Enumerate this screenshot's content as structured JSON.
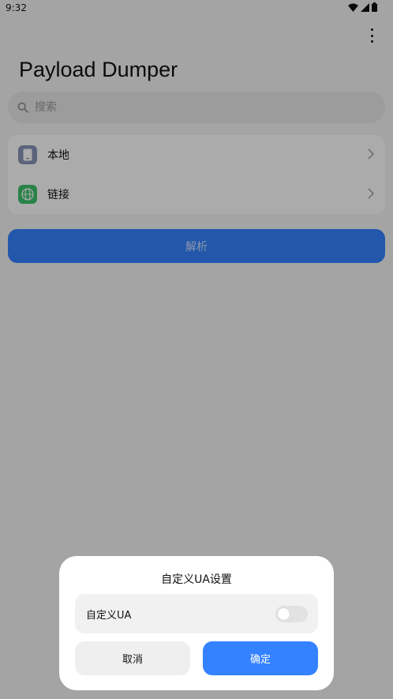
{
  "status_bar": {
    "time": "9:32"
  },
  "app": {
    "title": "Payload Dumper",
    "search": {
      "placeholder": "搜索",
      "value": ""
    },
    "sources": [
      {
        "label": "本地",
        "icon": "phone-icon"
      },
      {
        "label": "链接",
        "icon": "globe-icon"
      }
    ],
    "parse_label": "解析"
  },
  "dialog": {
    "title": "自定义UA设置",
    "toggle_label": "自定义UA",
    "toggle_on": false,
    "cancel_label": "取消",
    "confirm_label": "确定"
  },
  "colors": {
    "accent": "#3482ff",
    "scrim": "#000000"
  }
}
